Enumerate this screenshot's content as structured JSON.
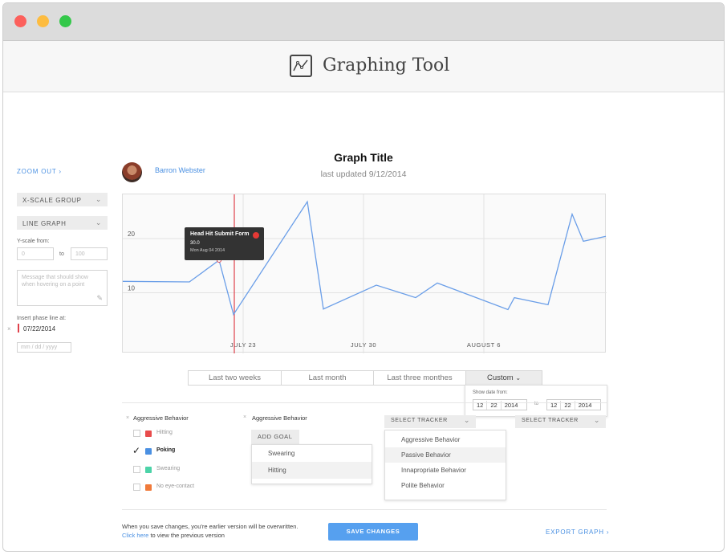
{
  "window": {
    "colors": {
      "close": "#fc605c",
      "minimize": "#fdbc40",
      "zoom": "#34c84a"
    }
  },
  "header": {
    "title": "Graphing Tool",
    "logo_icon": "line-chart-icon"
  },
  "sidebar": {
    "zoom_out": "ZOOM OUT",
    "x_scale": "X-SCALE GROUP",
    "graph_type": "LINE GRAPH",
    "y_scale_label": "Y-scale from:",
    "y_from": "0",
    "y_to_label": "to",
    "y_to": "100",
    "message_placeholder": "Message that should show when hovering on a point",
    "phase_label": "Insert phase line at:",
    "phase_date": "07/22/2014",
    "date_mm": "mm",
    "date_dd": "dd",
    "date_yyyy": "yyyy"
  },
  "graph": {
    "user_name": "Barron Webster",
    "title": "Graph Title",
    "last_updated": "last updated 9/12/2014",
    "tooltip": {
      "title": "Head Hit Submit Form",
      "value": "30.0",
      "date": "Mon Aug 04 2014",
      "color": "#e53935"
    },
    "line_color": "#6a9ee8",
    "phase_color": "#e0414b"
  },
  "chart_data": {
    "type": "line",
    "x_ticks": [
      "JULY 23",
      "JULY 30",
      "AUGUST 6"
    ],
    "y_ticks": [
      "20",
      "10"
    ],
    "points": [
      [
        0,
        12.1
      ],
      [
        83,
        12.0
      ],
      [
        120,
        16.0
      ],
      [
        138,
        6.0
      ],
      [
        230,
        26.8
      ],
      [
        250,
        7.0
      ],
      [
        316,
        11.4
      ],
      [
        365,
        9.1
      ],
      [
        392,
        11.8
      ],
      [
        480,
        6.9
      ],
      [
        488,
        9.1
      ],
      [
        530,
        7.8
      ],
      [
        560,
        24.5
      ],
      [
        574,
        19.5
      ],
      [
        602,
        20.4
      ]
    ],
    "ylim": [
      0,
      30
    ]
  },
  "range_tabs": {
    "items": [
      "Last two weeks",
      "Last month",
      "Last three monthes",
      "Custom"
    ],
    "show_from": "Show date from:",
    "from": {
      "mm": "12",
      "dd": "22",
      "yyyy": "2014"
    },
    "to_label": "to",
    "to": {
      "mm": "12",
      "dd": "22",
      "yyyy": "2014"
    }
  },
  "trackers": {
    "left_title": "Aggressive Behavior",
    "items": [
      {
        "label": "Hitting",
        "checked": false,
        "color": "#e84c4c"
      },
      {
        "label": "Poking",
        "checked": true,
        "color": "#4a90e2"
      },
      {
        "label": "Swearing",
        "checked": false,
        "color": "#4cd3a8"
      },
      {
        "label": "No eye-contact",
        "checked": false,
        "color": "#f07a3a"
      }
    ],
    "mid_title": "Aggressive Behavior",
    "add_goal": "ADD GOAL",
    "goal_options": [
      "Swearing",
      "Hitting"
    ],
    "select_tracker": "SELECT TRACKER",
    "select_tracker_2": "SELECT TRACKER",
    "tracker_options": [
      "Aggressive Behavior",
      "Passive Behavior",
      "Innapropriate Behavior",
      "Polite Behavior"
    ]
  },
  "footer": {
    "note_part1": "When you save changes, you're earlier version will be",
    "note_part2": "overwritten.",
    "note_link": "Click here",
    "note_part3": "to view the previous version",
    "save": "SAVE CHANGES",
    "export": "EXPORT GRAPH"
  }
}
